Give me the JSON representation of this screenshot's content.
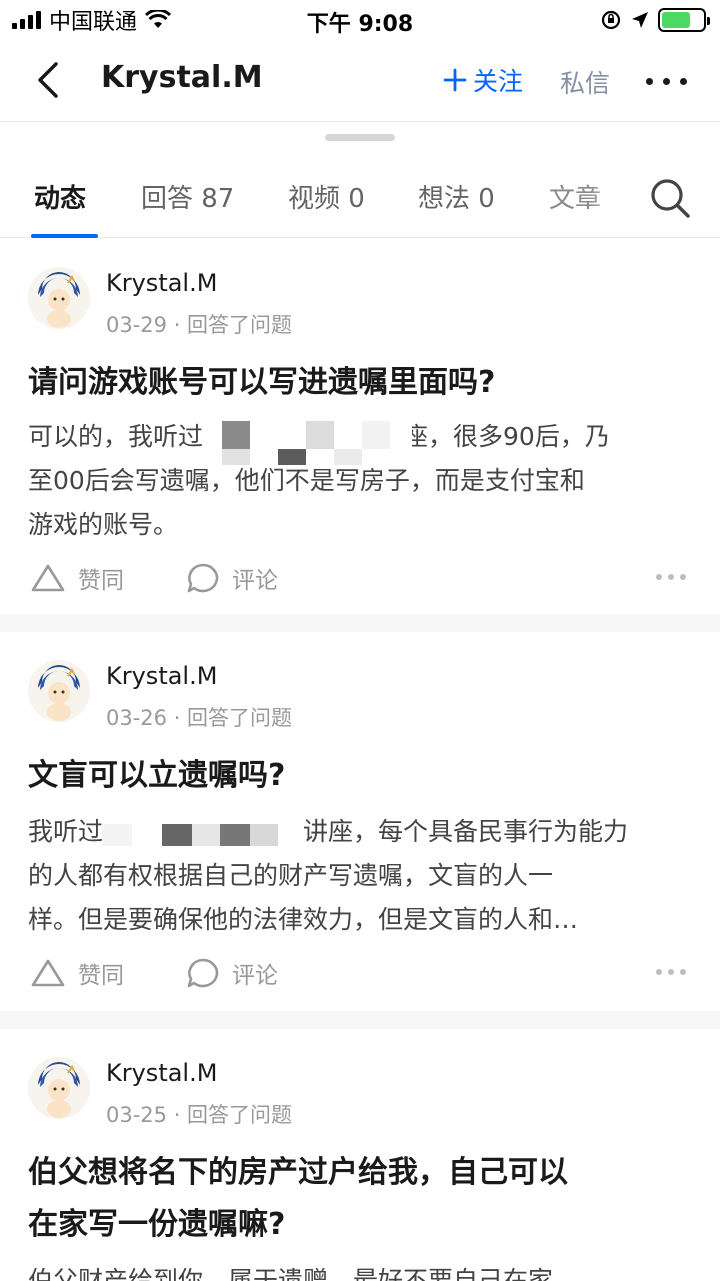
{
  "status_bar": {
    "carrier": "中国联通",
    "time": "下午 9:08"
  },
  "nav": {
    "title": "Krystal.M",
    "follow_label": "关注",
    "message_label": "私信"
  },
  "tabs": [
    {
      "label": "动态"
    },
    {
      "label": "回答 87"
    },
    {
      "label": "视频 0"
    },
    {
      "label": "想法 0"
    },
    {
      "label": "文章"
    }
  ],
  "feed": [
    {
      "author": "Krystal.M",
      "meta": "03-29 · 回答了问题",
      "title": "请问游戏账号可以写进遗嘱里面吗?",
      "excerpt_lines": [
        "可以的，我听过　　　　　　　讲座，很多90后，乃",
        "至00后会写遗嘱，他们不是写房子，而是支付宝和",
        "游戏的账号。"
      ],
      "like_label": "赞同",
      "comment_label": "评论"
    },
    {
      "author": "Krystal.M",
      "meta": "03-26 · 回答了问题",
      "title": "文盲可以立遗嘱吗?",
      "excerpt_lines": [
        "我听过　　　　　　　　讲座，每个具备民事行为能力",
        "的人都有权根据自己的财产写遗嘱，文盲的人一",
        "样。但是要确保他的法律效力，但是文盲的人和…"
      ],
      "like_label": "赞同",
      "comment_label": "评论"
    },
    {
      "author": "Krystal.M",
      "meta": "03-25 · 回答了问题",
      "title_lines": [
        "伯父想将名下的房产过户给我，自己可以",
        "在家写一份遗嘱嘛?"
      ],
      "excerpt_lines": [
        "伯父财产给到你，属于遗赠，最好不要自己在家"
      ]
    }
  ],
  "colors": {
    "accent": "#0066ff",
    "secondary": "#8590a6",
    "meta_gray": "#999999"
  }
}
